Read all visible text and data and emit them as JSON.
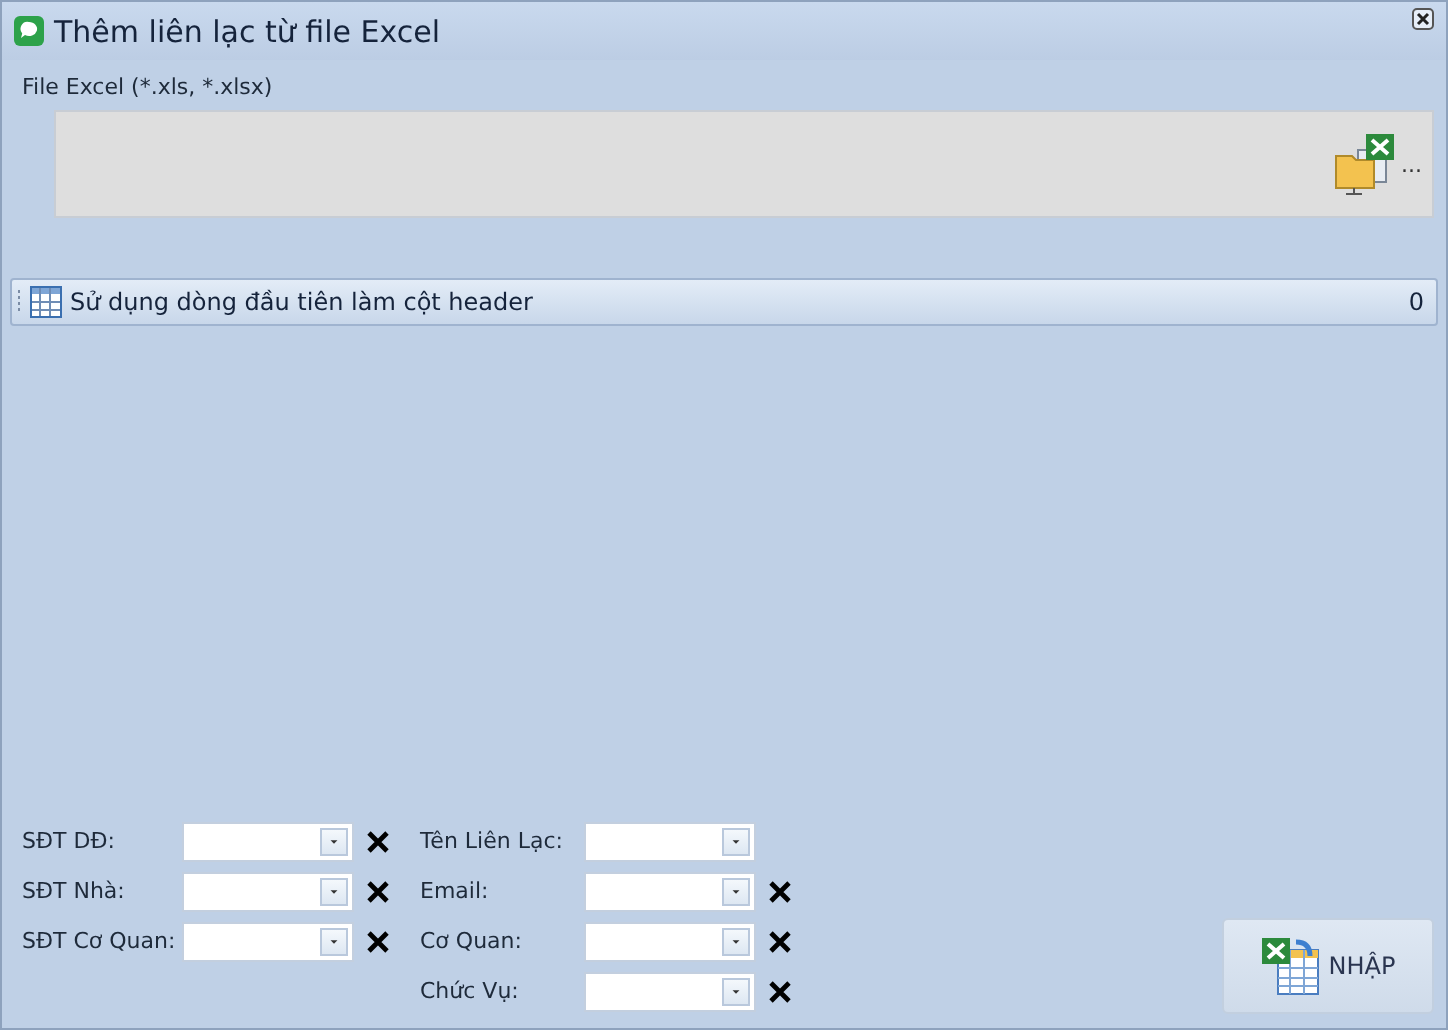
{
  "window": {
    "title": "Thêm liên lạc từ file Excel"
  },
  "file": {
    "label": "File Excel (*.xls, *.xlsx)",
    "browse_label": "..."
  },
  "header_bar": {
    "label": "Sử dụng dòng đầu tiên làm cột header",
    "count": "0"
  },
  "mapping_left": [
    {
      "label": "SĐT DĐ:",
      "clearable": true
    },
    {
      "label": "SĐT Nhà:",
      "clearable": true
    },
    {
      "label": "SĐT Cơ Quan:",
      "clearable": true
    }
  ],
  "mapping_right": [
    {
      "label": "Tên Liên Lạc:",
      "clearable": false
    },
    {
      "label": "Email:",
      "clearable": true
    },
    {
      "label": "Cơ Quan:",
      "clearable": true
    },
    {
      "label": "Chức Vụ:",
      "clearable": true
    }
  ],
  "import_button": {
    "label": "NHẬP"
  }
}
